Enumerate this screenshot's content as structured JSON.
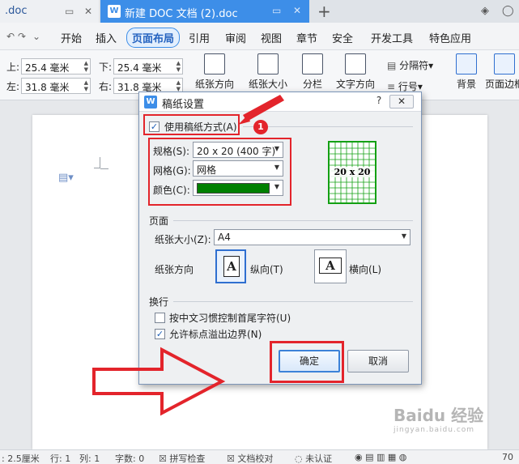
{
  "tabs": [
    {
      "label": ".doc"
    },
    {
      "label": "新建 DOC 文档 (2).doc"
    }
  ],
  "menu": {
    "items": [
      "开始",
      "插入",
      "页面布局",
      "引用",
      "审阅",
      "视图",
      "章节",
      "安全",
      "开发工具",
      "特色应用"
    ],
    "active": "页面布局"
  },
  "ribbon": {
    "margins": {
      "top_label": "上:",
      "top_value": "25.4 毫米",
      "bottom_label": "下:",
      "bottom_value": "25.4 毫米",
      "left_label": "左:",
      "left_value": "31.8 毫米",
      "right_label": "右:",
      "right_value": "31.8 毫米"
    },
    "buttons": [
      "纸张方向",
      "纸张大小",
      "分栏",
      "文字方向",
      "分隔符",
      "行号",
      "背景",
      "页面边框"
    ]
  },
  "dialog": {
    "title": "稿纸设置",
    "use_grid_label": "使用稿纸方式(A)",
    "use_grid_checked": true,
    "spec_label": "规格(S):",
    "spec_value": "20 x 20 (400 字)",
    "grid_label": "网格(G):",
    "grid_value": "网格",
    "color_label": "颜色(C):",
    "color_value": "#008000",
    "preview_label": "20 x 20",
    "page_section": "页面",
    "paper_size_label": "纸张大小(Z):",
    "paper_size_value": "A4",
    "orientation_label": "纸张方向",
    "portrait_label": "纵向(T)",
    "landscape_label": "横向(L)",
    "orientation_glyph": "A",
    "wrap_section": "换行",
    "option1_label": "按中文习惯控制首尾字符(U)",
    "option1_checked": false,
    "option2_label": "允许标点溢出边界(N)",
    "option2_checked": true,
    "ok_label": "确定",
    "cancel_label": "取消"
  },
  "annotation": {
    "badge": "1"
  },
  "statusbar": {
    "position": ": 2.5厘米",
    "row": "行: 1",
    "col": "列: 1",
    "words": "字数: 0",
    "spell": "拼写检查",
    "proof": "文档校对",
    "auth": "未认证",
    "zoom": "70"
  },
  "watermark": {
    "text": "Baidu 经验",
    "sub": "jingyan.baidu.com"
  }
}
